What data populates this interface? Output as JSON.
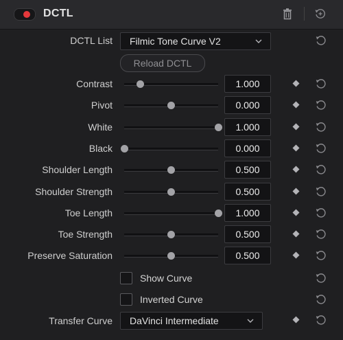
{
  "header": {
    "title": "DCTL",
    "enabled": true,
    "toggle_color": "#e5383b"
  },
  "dctl_list": {
    "label": "DCTL List",
    "value": "Filmic Tone Curve V2"
  },
  "reload_button": {
    "label": "Reload DCTL"
  },
  "params": [
    {
      "label": "Contrast",
      "value": "1.000",
      "slider_fraction": 0.17
    },
    {
      "label": "Pivot",
      "value": "0.000",
      "slider_fraction": 0.5
    },
    {
      "label": "White",
      "value": "1.000",
      "slider_fraction": 1.0
    },
    {
      "label": "Black",
      "value": "0.000",
      "slider_fraction": 0.0
    },
    {
      "label": "Shoulder Length",
      "value": "0.500",
      "slider_fraction": 0.5
    },
    {
      "label": "Shoulder Strength",
      "value": "0.500",
      "slider_fraction": 0.5
    },
    {
      "label": "Toe Length",
      "value": "1.000",
      "slider_fraction": 1.0
    },
    {
      "label": "Toe Strength",
      "value": "0.500",
      "slider_fraction": 0.5
    },
    {
      "label": "Preserve Saturation",
      "value": "0.500",
      "slider_fraction": 0.5
    }
  ],
  "checkboxes": [
    {
      "label": "Show Curve",
      "checked": false
    },
    {
      "label": "Inverted Curve",
      "checked": false
    }
  ],
  "transfer_curve": {
    "label": "Transfer Curve",
    "value": "DaVinci Intermediate"
  },
  "icons": {
    "delete": "trash-icon",
    "reset_all": "reset-all-icon",
    "keyframe": "keyframe-diamond-icon",
    "reset": "reset-icon",
    "dropdown": "chevron-down-icon"
  }
}
